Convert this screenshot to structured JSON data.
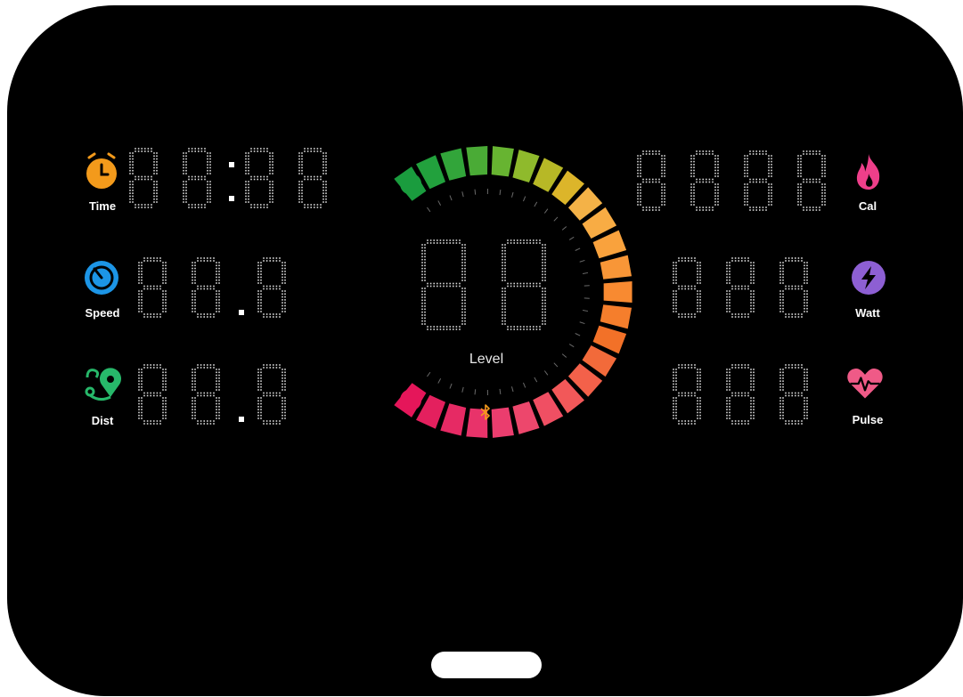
{
  "stats_left": [
    {
      "label": "Time",
      "icon": "alarm-clock-icon",
      "color": "#f39a1b"
    },
    {
      "label": "Speed",
      "icon": "speedometer-icon",
      "color": "#1c95e6"
    },
    {
      "label": "Dist",
      "icon": "map-pin-icon",
      "color": "#27b86a"
    }
  ],
  "stats_right": [
    {
      "label": "Cal",
      "icon": "flame-icon",
      "color": "#ee3f8a"
    },
    {
      "label": "Watt",
      "icon": "lightning-icon",
      "color": "#8d5fd3"
    },
    {
      "label": "Pulse",
      "icon": "heart-pulse-icon",
      "color": "#ef5a87"
    }
  ],
  "gauge": {
    "label": "Level",
    "colors": [
      "#1a9c3e",
      "#22a13d",
      "#32a53a",
      "#4aab36",
      "#67b431",
      "#8fba2c",
      "#b7b826",
      "#dcb52a",
      "#f4b247",
      "#f8ac44",
      "#f9a23d",
      "#f89637",
      "#f88a31",
      "#f57e2c",
      "#f27128",
      "#f26a3a",
      "#f3614a",
      "#f25859",
      "#f04f63",
      "#ed476c",
      "#eb3d6e",
      "#e8336a",
      "#e62a64",
      "#e4205e",
      "#e5165a"
    ]
  },
  "bluetooth_icon": "bluetooth-icon",
  "home_button": "home-button"
}
